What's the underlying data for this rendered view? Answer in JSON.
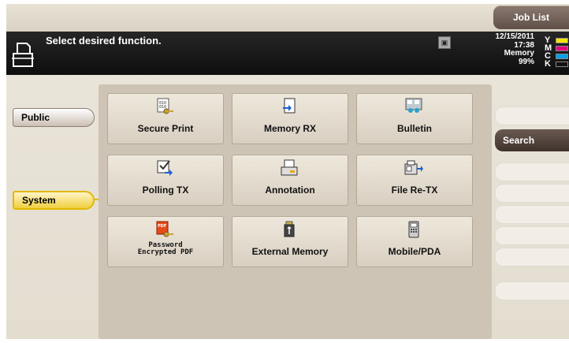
{
  "header": {
    "job_list_label": "Job List",
    "message": "Select desired function.",
    "date": "12/15/2011",
    "time": "17:38",
    "memory_label": "Memory",
    "memory_value": "99%",
    "toner": [
      {
        "letter": "Y",
        "color": "#f5e400"
      },
      {
        "letter": "M",
        "color": "#e3007f"
      },
      {
        "letter": "C",
        "color": "#00a0e9"
      },
      {
        "letter": "K",
        "color": "#111111"
      }
    ]
  },
  "sidebar": {
    "public_label": "Public",
    "system_label": "System"
  },
  "tiles": [
    {
      "label": "Secure Print",
      "icon": "secure-print-icon"
    },
    {
      "label": "Memory RX",
      "icon": "memory-rx-icon"
    },
    {
      "label": "Bulletin",
      "icon": "bulletin-icon"
    },
    {
      "label": "Polling TX",
      "icon": "polling-tx-icon"
    },
    {
      "label": "Annotation",
      "icon": "annotation-icon"
    },
    {
      "label": "File Re-TX",
      "icon": "file-retx-icon"
    },
    {
      "label_line1": "Password",
      "label_line2": "Encrypted PDF",
      "icon": "pdf-lock-icon"
    },
    {
      "label": "External Memory",
      "icon": "usb-memory-icon"
    },
    {
      "label": "Mobile/PDA",
      "icon": "mobile-pda-icon"
    }
  ],
  "right": {
    "search_label": "Search"
  },
  "colors": {
    "accent_yellow": "#f0cf3e",
    "header_dark": "#111111",
    "panel_bg": "#cdc4b6"
  }
}
